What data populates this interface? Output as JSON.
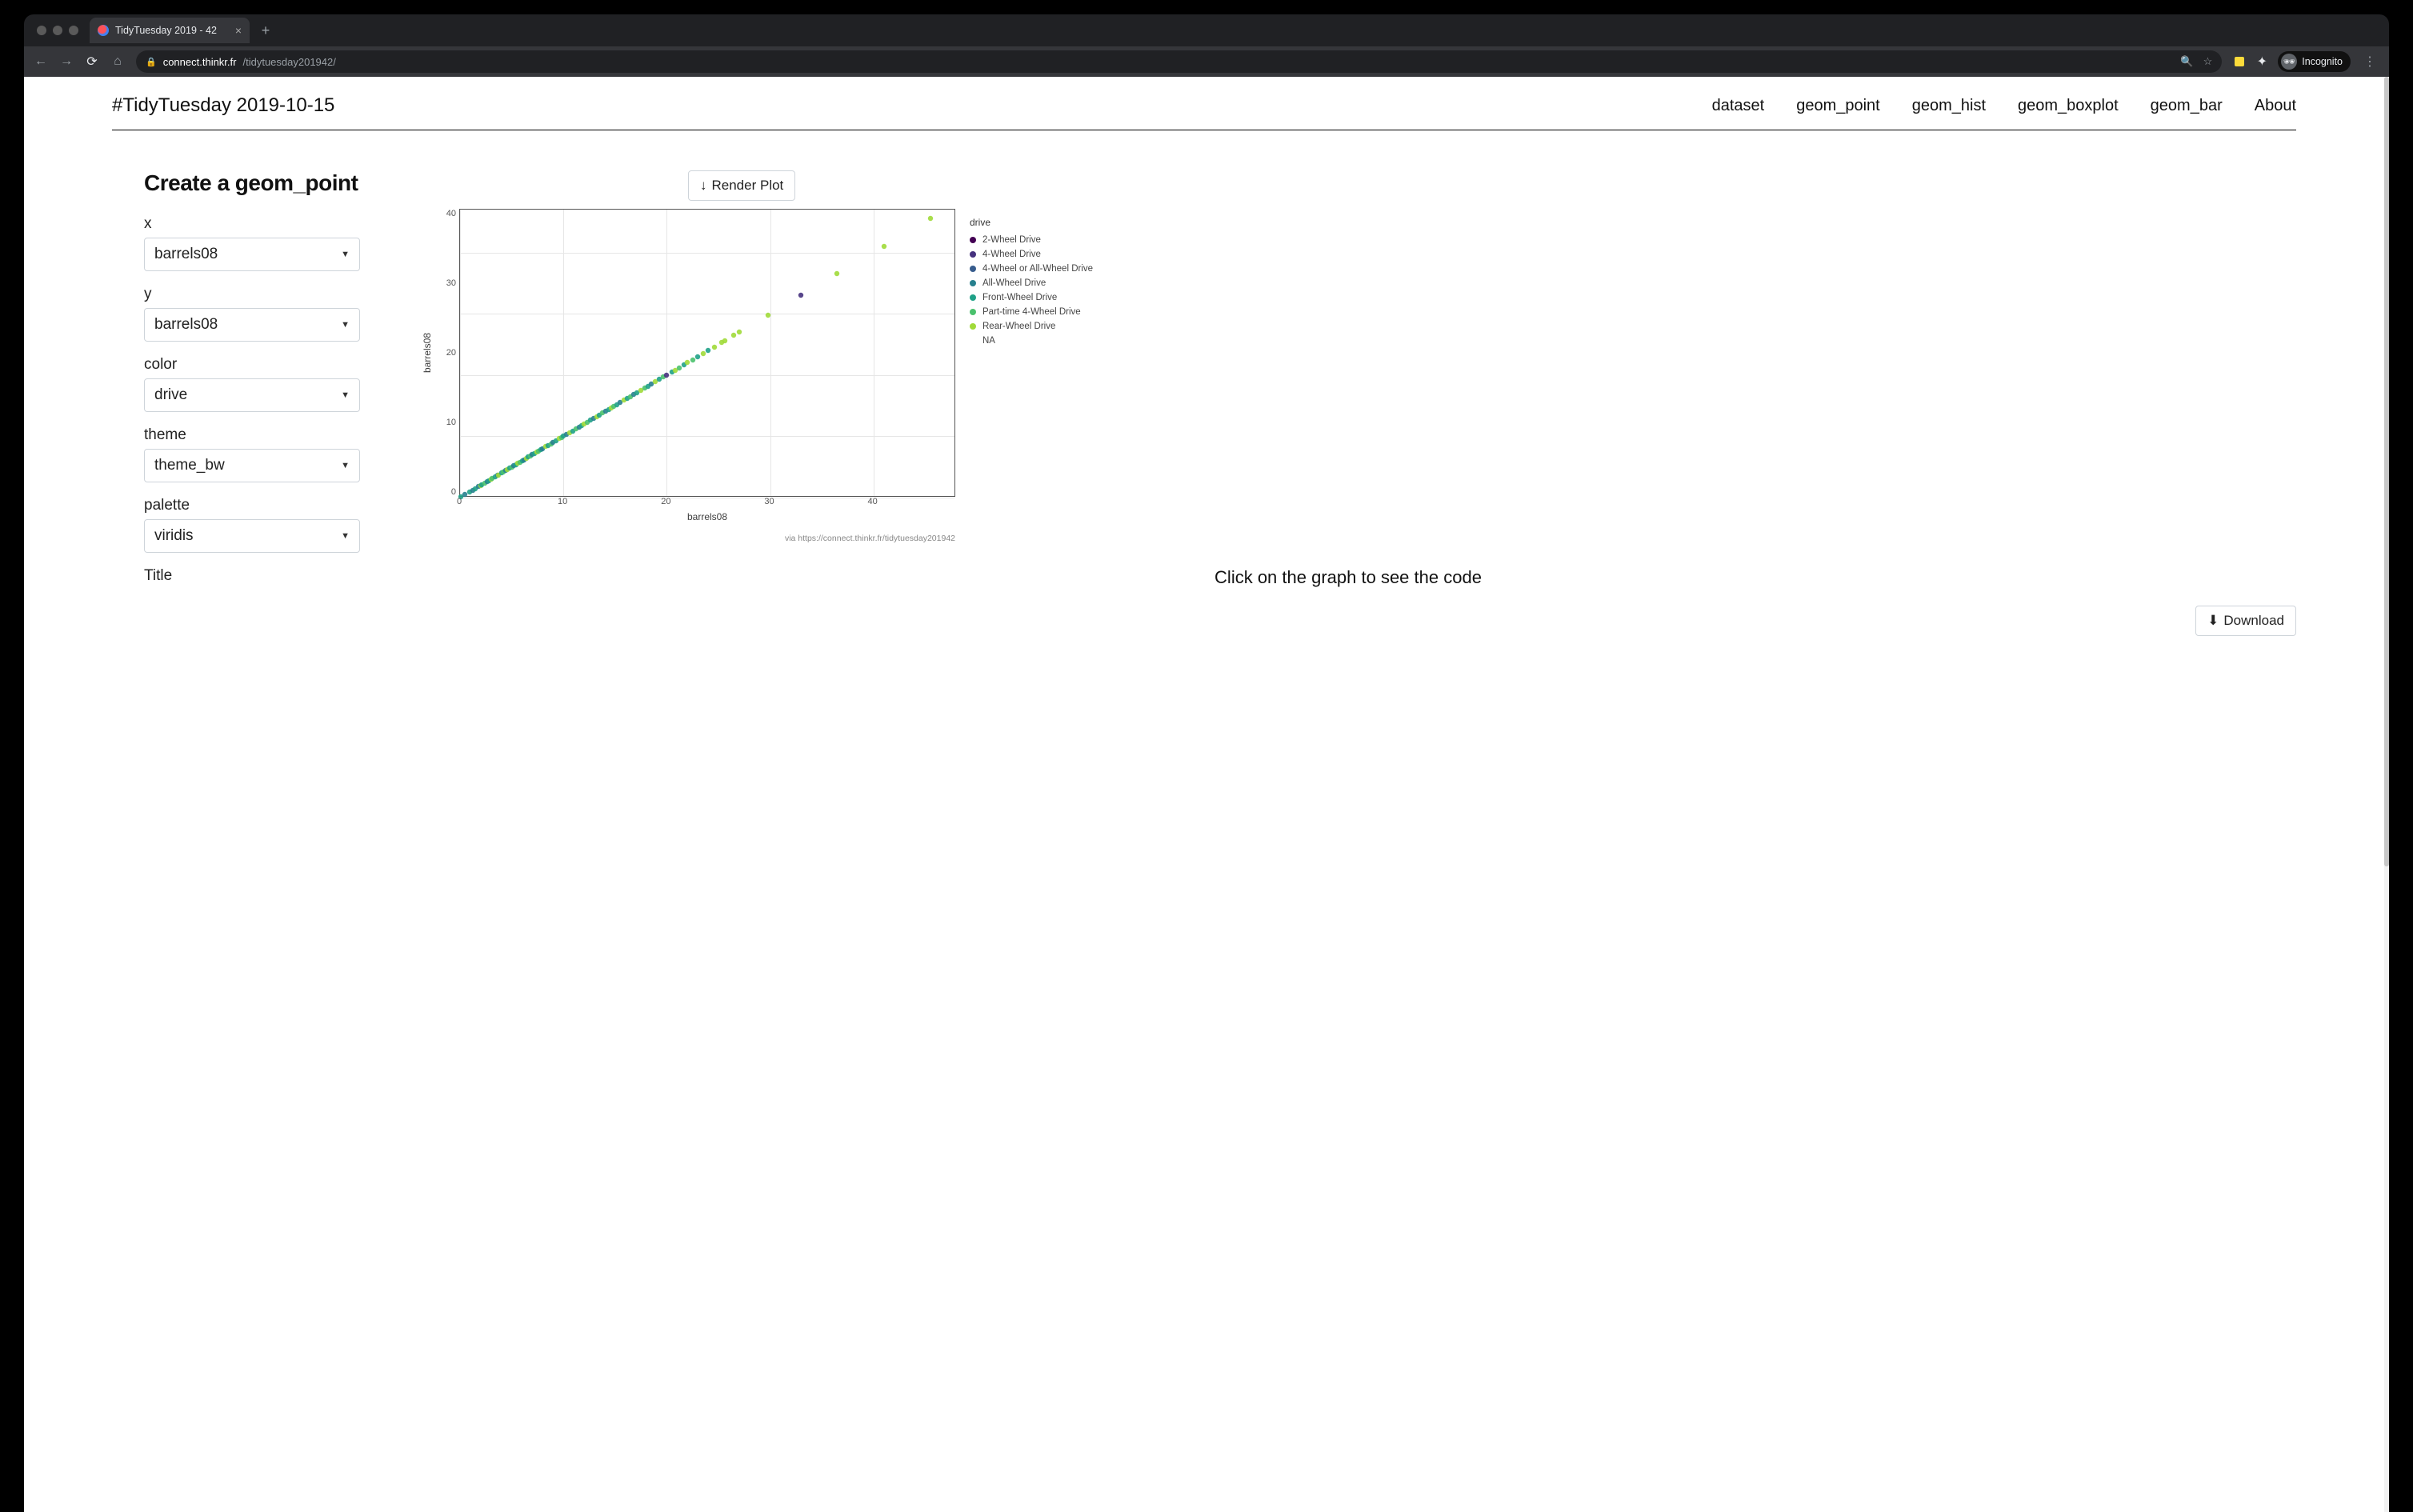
{
  "browser": {
    "tab_title": "TidyTuesday 2019 - 42",
    "new_tab_label": "+",
    "url_host": "connect.thinkr.fr",
    "url_path": "/tidytuesday201942/",
    "incognito_label": "Incognito"
  },
  "header": {
    "brand": "#TidyTuesday 2019-10-15",
    "nav": [
      "dataset",
      "geom_point",
      "geom_hist",
      "geom_boxplot",
      "geom_bar",
      "About"
    ]
  },
  "form": {
    "title": "Create a geom_point",
    "fields": {
      "x": {
        "label": "x",
        "value": "barrels08"
      },
      "y": {
        "label": "y",
        "value": "barrels08"
      },
      "color": {
        "label": "color",
        "value": "drive"
      },
      "theme": {
        "label": "theme",
        "value": "theme_bw"
      },
      "palette": {
        "label": "palette",
        "value": "viridis"
      },
      "title": {
        "label": "Title"
      }
    }
  },
  "buttons": {
    "render": "Render Plot",
    "download": "Download"
  },
  "hint": "Click on the graph to see the code",
  "chart_data": {
    "type": "scatter",
    "xlabel": "barrels08",
    "ylabel": "barrels08",
    "xlim": [
      0,
      48
    ],
    "ylim": [
      0,
      47
    ],
    "xticks": [
      0,
      10,
      20,
      30,
      40
    ],
    "yticks": [
      0,
      10,
      20,
      30,
      40
    ],
    "legend_title": "drive",
    "source_note": "via https://connect.thinkr.fr/tidytuesday201942",
    "series": [
      {
        "name": "2-Wheel Drive",
        "color": "#440154"
      },
      {
        "name": "4-Wheel Drive",
        "color": "#46327e"
      },
      {
        "name": "4-Wheel or All-Wheel Drive",
        "color": "#375c8d"
      },
      {
        "name": "All-Wheel Drive",
        "color": "#27808e"
      },
      {
        "name": "Front-Wheel Drive",
        "color": "#1fa187"
      },
      {
        "name": "Part-time 4-Wheel Drive",
        "color": "#4ac16d"
      },
      {
        "name": "Rear-Wheel Drive",
        "color": "#a0da39"
      },
      {
        "name": "NA",
        "color": ""
      }
    ],
    "points": [
      {
        "x": 0.1,
        "y": 0.1,
        "s": 4
      },
      {
        "x": 0.5,
        "y": 0.5,
        "s": 3
      },
      {
        "x": 0.9,
        "y": 0.9,
        "s": 4
      },
      {
        "x": 1.2,
        "y": 1.2,
        "s": 3
      },
      {
        "x": 1.5,
        "y": 1.5,
        "s": 4
      },
      {
        "x": 1.8,
        "y": 1.8,
        "s": 3
      },
      {
        "x": 2.0,
        "y": 2.0,
        "s": 6
      },
      {
        "x": 2.1,
        "y": 2.1,
        "s": 4
      },
      {
        "x": 2.4,
        "y": 2.4,
        "s": 5
      },
      {
        "x": 2.6,
        "y": 2.6,
        "s": 3
      },
      {
        "x": 2.8,
        "y": 2.8,
        "s": 4
      },
      {
        "x": 3.0,
        "y": 3.0,
        "s": 6
      },
      {
        "x": 3.1,
        "y": 3.1,
        "s": 5
      },
      {
        "x": 3.4,
        "y": 3.4,
        "s": 4
      },
      {
        "x": 3.6,
        "y": 3.6,
        "s": 3
      },
      {
        "x": 3.7,
        "y": 3.7,
        "s": 6
      },
      {
        "x": 4.0,
        "y": 4.0,
        "s": 4
      },
      {
        "x": 4.2,
        "y": 4.2,
        "s": 5
      },
      {
        "x": 4.4,
        "y": 4.4,
        "s": 3
      },
      {
        "x": 4.6,
        "y": 4.6,
        "s": 6
      },
      {
        "x": 4.8,
        "y": 4.8,
        "s": 4
      },
      {
        "x": 5.0,
        "y": 5.0,
        "s": 5
      },
      {
        "x": 5.2,
        "y": 5.2,
        "s": 3
      },
      {
        "x": 5.4,
        "y": 5.4,
        "s": 4
      },
      {
        "x": 5.6,
        "y": 5.6,
        "s": 6
      },
      {
        "x": 5.8,
        "y": 5.8,
        "s": 5
      },
      {
        "x": 6.0,
        "y": 6.0,
        "s": 4
      },
      {
        "x": 6.2,
        "y": 6.2,
        "s": 3
      },
      {
        "x": 6.4,
        "y": 6.4,
        "s": 6
      },
      {
        "x": 6.6,
        "y": 6.6,
        "s": 4
      },
      {
        "x": 6.8,
        "y": 6.8,
        "s": 5
      },
      {
        "x": 7.0,
        "y": 7.0,
        "s": 3
      },
      {
        "x": 7.2,
        "y": 7.2,
        "s": 4
      },
      {
        "x": 7.4,
        "y": 7.4,
        "s": 6
      },
      {
        "x": 7.6,
        "y": 7.6,
        "s": 5
      },
      {
        "x": 7.8,
        "y": 7.8,
        "s": 4
      },
      {
        "x": 8.0,
        "y": 8.0,
        "s": 3
      },
      {
        "x": 8.3,
        "y": 8.3,
        "s": 6
      },
      {
        "x": 8.5,
        "y": 8.5,
        "s": 4
      },
      {
        "x": 8.8,
        "y": 8.8,
        "s": 5
      },
      {
        "x": 9.0,
        "y": 9.0,
        "s": 3
      },
      {
        "x": 9.3,
        "y": 9.3,
        "s": 4
      },
      {
        "x": 9.6,
        "y": 9.6,
        "s": 6
      },
      {
        "x": 9.8,
        "y": 9.8,
        "s": 5
      },
      {
        "x": 10.0,
        "y": 10.0,
        "s": 4
      },
      {
        "x": 10.3,
        "y": 10.3,
        "s": 3
      },
      {
        "x": 10.6,
        "y": 10.6,
        "s": 6
      },
      {
        "x": 10.9,
        "y": 10.9,
        "s": 4
      },
      {
        "x": 11.2,
        "y": 11.2,
        "s": 5
      },
      {
        "x": 11.5,
        "y": 11.5,
        "s": 3
      },
      {
        "x": 11.8,
        "y": 11.8,
        "s": 4
      },
      {
        "x": 12.0,
        "y": 12.0,
        "s": 6
      },
      {
        "x": 12.3,
        "y": 12.3,
        "s": 5
      },
      {
        "x": 12.6,
        "y": 12.6,
        "s": 4
      },
      {
        "x": 12.9,
        "y": 12.9,
        "s": 3
      },
      {
        "x": 13.2,
        "y": 13.2,
        "s": 6
      },
      {
        "x": 13.5,
        "y": 13.5,
        "s": 4
      },
      {
        "x": 13.8,
        "y": 13.8,
        "s": 5
      },
      {
        "x": 14.1,
        "y": 14.1,
        "s": 3
      },
      {
        "x": 14.4,
        "y": 14.4,
        "s": 4
      },
      {
        "x": 14.6,
        "y": 14.6,
        "s": 6
      },
      {
        "x": 14.9,
        "y": 14.9,
        "s": 5
      },
      {
        "x": 15.2,
        "y": 15.2,
        "s": 4
      },
      {
        "x": 15.5,
        "y": 15.5,
        "s": 3
      },
      {
        "x": 15.9,
        "y": 15.9,
        "s": 6
      },
      {
        "x": 16.2,
        "y": 16.2,
        "s": 4
      },
      {
        "x": 16.5,
        "y": 16.5,
        "s": 5
      },
      {
        "x": 16.8,
        "y": 16.8,
        "s": 3
      },
      {
        "x": 17.1,
        "y": 17.1,
        "s": 4
      },
      {
        "x": 17.5,
        "y": 17.5,
        "s": 6
      },
      {
        "x": 17.9,
        "y": 17.9,
        "s": 5
      },
      {
        "x": 18.2,
        "y": 18.2,
        "s": 4
      },
      {
        "x": 18.5,
        "y": 18.5,
        "s": 3
      },
      {
        "x": 18.9,
        "y": 18.9,
        "s": 6
      },
      {
        "x": 19.3,
        "y": 19.3,
        "s": 4
      },
      {
        "x": 19.7,
        "y": 19.7,
        "s": 5
      },
      {
        "x": 20.0,
        "y": 20.0,
        "s": 1
      },
      {
        "x": 20.5,
        "y": 20.5,
        "s": 4
      },
      {
        "x": 20.8,
        "y": 20.8,
        "s": 6
      },
      {
        "x": 21.2,
        "y": 21.2,
        "s": 5
      },
      {
        "x": 21.7,
        "y": 21.7,
        "s": 4
      },
      {
        "x": 22.0,
        "y": 22.0,
        "s": 6
      },
      {
        "x": 22.5,
        "y": 22.5,
        "s": 5
      },
      {
        "x": 23.0,
        "y": 23.0,
        "s": 4
      },
      {
        "x": 23.5,
        "y": 23.5,
        "s": 6
      },
      {
        "x": 24.0,
        "y": 24.0,
        "s": 4
      },
      {
        "x": 24.6,
        "y": 24.6,
        "s": 6
      },
      {
        "x": 25.3,
        "y": 25.3,
        "s": 6
      },
      {
        "x": 25.6,
        "y": 25.6,
        "s": 6
      },
      {
        "x": 26.5,
        "y": 26.5,
        "s": 6
      },
      {
        "x": 27.0,
        "y": 27.0,
        "s": 6
      },
      {
        "x": 29.8,
        "y": 29.8,
        "s": 6
      },
      {
        "x": 33.0,
        "y": 33.0,
        "s": 1
      },
      {
        "x": 36.5,
        "y": 36.5,
        "s": 6
      },
      {
        "x": 41.0,
        "y": 41.0,
        "s": 6
      },
      {
        "x": 45.5,
        "y": 45.5,
        "s": 6
      }
    ]
  }
}
